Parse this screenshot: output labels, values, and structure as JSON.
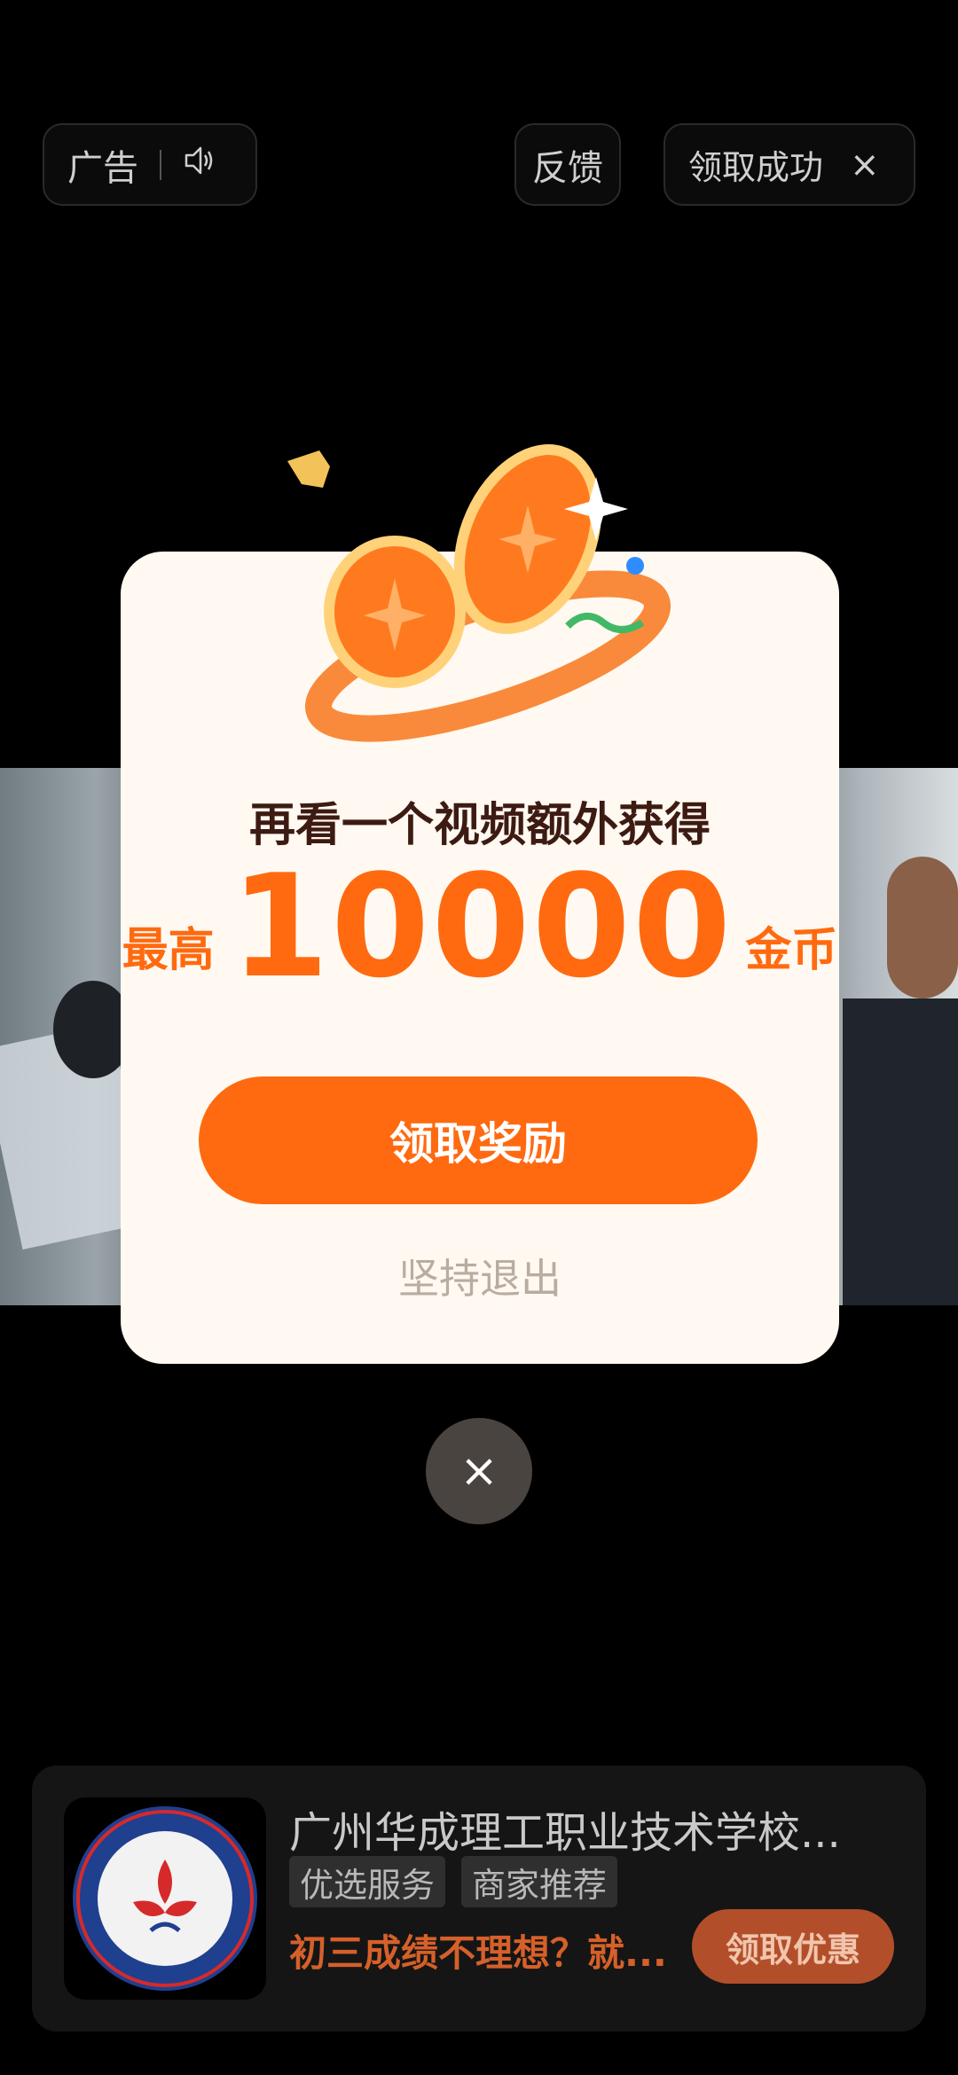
{
  "top_bar": {
    "ad_label": "广告",
    "feedback_label": "反馈",
    "claimed_label": "领取成功",
    "close_symbol": "×"
  },
  "dialog": {
    "headline": "再看一个视频额外获得",
    "prefix": "最高",
    "amount": "10000",
    "unit": "金币",
    "claim_button": "领取奖励",
    "quit_link": "坚持退出"
  },
  "close_button": {
    "symbol": "×"
  },
  "ad_card": {
    "title": "广州华成理工职业技术学校...",
    "tags": [
      "优选服务",
      "商家推荐"
    ],
    "description": "初三成绩不理想？就...",
    "cta": "领取优惠"
  },
  "colors": {
    "accent": "#ff6a10",
    "dialog_bg": "#fff9f1",
    "headline": "#3d1b12"
  }
}
